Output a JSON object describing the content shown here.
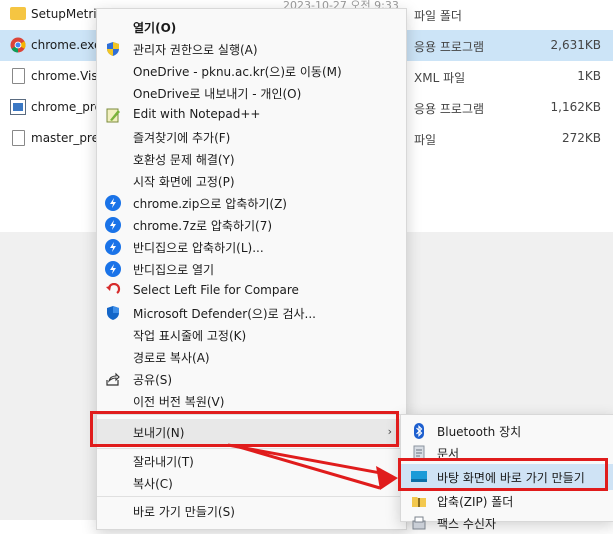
{
  "files": [
    {
      "name": "SetupMetrics",
      "date": "2023-10-27 오전 9:33",
      "type": "파일 폴더",
      "size": "",
      "icon": "folder-icon"
    },
    {
      "name": "chrome.exe",
      "date": "",
      "type": "응용 프로그램",
      "size": "2,631KB",
      "icon": "chrome-icon",
      "selected": true
    },
    {
      "name": "chrome.VisualElementsManifest.xml",
      "date": "",
      "type": "XML 파일",
      "size": "1KB",
      "icon": "xml-file-icon"
    },
    {
      "name": "chrome_proxy.exe",
      "date": "",
      "type": "응용 프로그램",
      "size": "1,162KB",
      "icon": "app-icon"
    },
    {
      "name": "master_preferences",
      "date": "",
      "type": "파일",
      "size": "272KB",
      "icon": "file-icon"
    }
  ],
  "context_menu": {
    "items": [
      {
        "label": "열기(O)",
        "icon": "",
        "bold": true
      },
      {
        "label": "관리자 권한으로 실행(A)",
        "icon": "uac-shield-icon"
      },
      {
        "label": "OneDrive - pknu.ac.kr(으)로 이동(M)",
        "icon": ""
      },
      {
        "label": "OneDrive로 내보내기 - 개인(O)",
        "icon": ""
      },
      {
        "label": "Edit with Notepad++",
        "icon": "notepadpp-icon"
      },
      {
        "label": "즐겨찾기에 추가(F)",
        "icon": ""
      },
      {
        "label": "호환성 문제 해결(Y)",
        "icon": ""
      },
      {
        "label": "시작 화면에 고정(P)",
        "icon": ""
      },
      {
        "label": "chrome.zip으로 압축하기(Z)",
        "icon": "bandizip-icon"
      },
      {
        "label": "chrome.7z로 압축하기(7)",
        "icon": "bandizip-icon"
      },
      {
        "label": "반디집으로 압축하기(L)...",
        "icon": "bandizip-icon"
      },
      {
        "label": "반디집으로 열기",
        "icon": "bandizip-icon"
      },
      {
        "label": "Select Left File for Compare",
        "icon": "compare-icon"
      },
      {
        "label": "Microsoft Defender(으)로 검사...",
        "icon": "defender-icon"
      },
      {
        "label": "작업 표시줄에 고정(K)",
        "icon": ""
      },
      {
        "label": "경로로 복사(A)",
        "icon": ""
      },
      {
        "label": "공유(S)",
        "icon": "share-icon"
      },
      {
        "label": "이전 버전 복원(V)",
        "icon": ""
      },
      {
        "label": "보내기(N)",
        "icon": "",
        "submenu": true
      },
      {
        "label": "잘라내기(T)",
        "icon": ""
      },
      {
        "label": "복사(C)",
        "icon": ""
      },
      {
        "label": "바로 가기 만들기(S)",
        "icon": ""
      }
    ]
  },
  "submenu": {
    "items": [
      {
        "label": "Bluetooth 장치",
        "icon": "bluetooth-icon"
      },
      {
        "label": "문서",
        "icon": "documents-icon"
      },
      {
        "label": "바탕 화면에 바로 가기 만들기",
        "icon": "desktop-icon",
        "highlighted": true
      },
      {
        "label": "압축(ZIP) 폴더",
        "icon": "zip-folder-icon"
      },
      {
        "label": "팩스 수신자",
        "icon": "fax-icon"
      }
    ]
  },
  "colors": {
    "annotation": "#e01c1c",
    "selection": "#cce4f7",
    "bandizip": "#1a73e8"
  }
}
